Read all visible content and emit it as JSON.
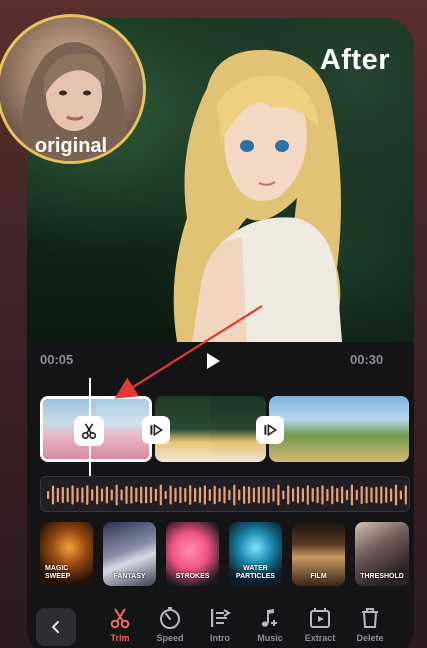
{
  "preview": {
    "after_label": "After",
    "original_label": "original"
  },
  "player": {
    "current_time": "00:05",
    "total_time": "00:30"
  },
  "effects": [
    {
      "label": "MAGIC\nSWEEP",
      "name": "effect-magic-sweep"
    },
    {
      "label": "FANTASY",
      "name": "effect-fantasy"
    },
    {
      "label": "STROKES",
      "name": "effect-strokes"
    },
    {
      "label": "WATER\nPARTICLES",
      "name": "effect-water-particles"
    },
    {
      "label": "FILM",
      "name": "effect-film"
    },
    {
      "label": "THRESHOLD",
      "name": "effect-threshold"
    }
  ],
  "toolbar": {
    "trim": "Trim",
    "speed": "Speed",
    "intro": "Intro",
    "music": "Music",
    "extract": "Extract",
    "delete": "Delete"
  },
  "colors": {
    "accent": "#f06a5e",
    "ring": "#e8c25a",
    "waveform": "#e8a07a"
  }
}
